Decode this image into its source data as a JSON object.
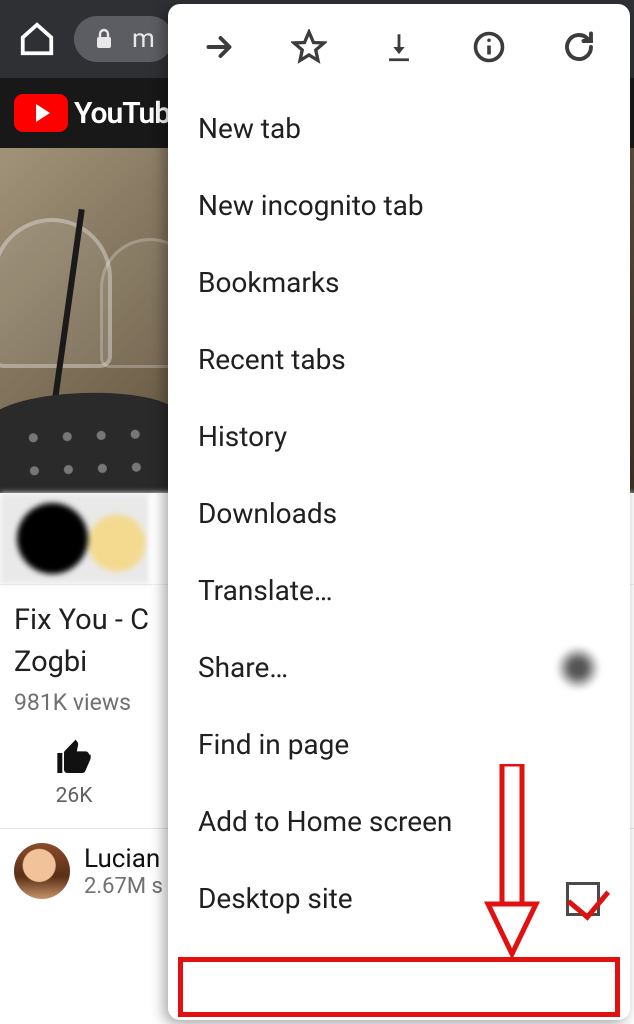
{
  "addressbar": {
    "url_text": "m"
  },
  "youtube": {
    "brand": "YouTube",
    "video_title": "Fix You - C\nZogbi",
    "title_line1": "Fix You - C",
    "title_line2": "Zogbi",
    "views": "981K views",
    "like_count": "26K",
    "channel_name": "Lucian",
    "subscribers": "2.67M s"
  },
  "menu": {
    "items": {
      "new_tab": "New tab",
      "new_incognito": "New incognito tab",
      "bookmarks": "Bookmarks",
      "recent_tabs": "Recent tabs",
      "history": "History",
      "downloads": "Downloads",
      "translate": "Translate…",
      "share": "Share…",
      "find_in_page": "Find in page",
      "add_home": "Add to Home screen",
      "desktop_site": "Desktop site"
    }
  }
}
